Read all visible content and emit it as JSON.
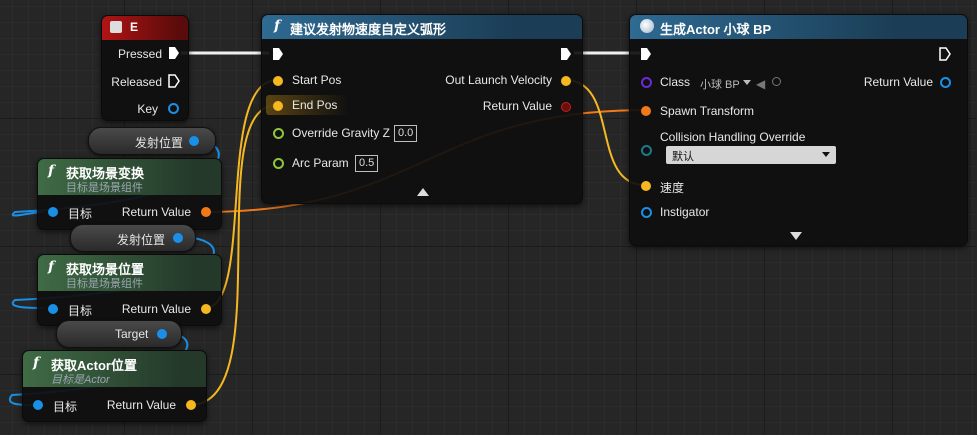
{
  "colors": {
    "vector": "#f5b821",
    "transform": "#f07a1a",
    "object": "#1a8fe6",
    "struct_ret": "#c41f1f",
    "class": "#6a2bd6",
    "bool": "#8ec83a"
  },
  "event_e": {
    "key_label": "E",
    "pins": {
      "pressed": "Pressed",
      "released": "Released",
      "key": "Key"
    }
  },
  "var_fire_pos_1": {
    "label": "发射位置"
  },
  "var_fire_pos_2": {
    "label": "发射位置"
  },
  "var_target": {
    "label": "Target"
  },
  "get_scene_transform": {
    "title": "获取场景变换",
    "subtitle": "目标是场景组件",
    "in_label": "目标",
    "out_label": "Return Value"
  },
  "get_scene_location": {
    "title": "获取场景位置",
    "subtitle": "目标是场景组件",
    "in_label": "目标",
    "out_label": "Return Value"
  },
  "get_actor_location": {
    "title": "获取Actor位置",
    "subtitle": "目标是Actor",
    "in_label": "目标",
    "out_label": "Return Value"
  },
  "suggest_arc": {
    "title": "建议发射物速度自定义弧形",
    "pins": {
      "start": "Start Pos",
      "end": "End Pos",
      "gravity": "Override Gravity Z",
      "gravity_val": "0.0",
      "arc": "Arc Param",
      "arc_val": "0.5",
      "out_vel": "Out Launch Velocity",
      "ret": "Return Value"
    }
  },
  "spawn_actor": {
    "title": "生成Actor 小球 BP",
    "pins": {
      "class": "Class",
      "class_val": "小球 BP",
      "ret": "Return Value",
      "spawn_transform": "Spawn Transform",
      "collision": "Collision Handling Override",
      "collision_val": "默认",
      "speed": "速度",
      "instigator": "Instigator"
    }
  }
}
